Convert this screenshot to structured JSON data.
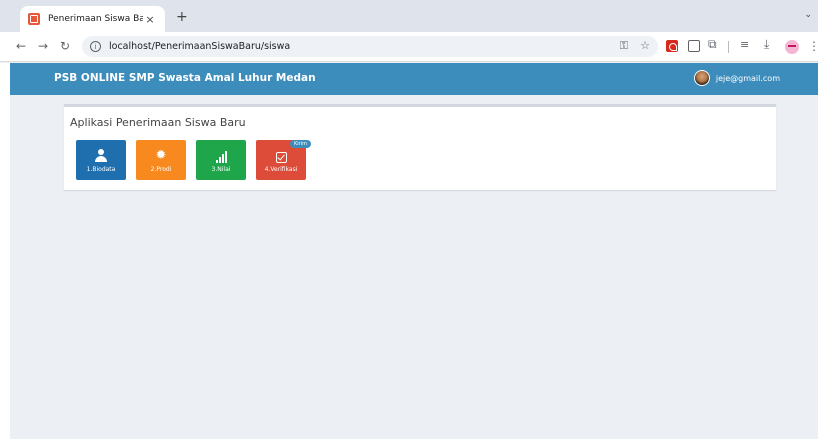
{
  "browser": {
    "tab_title": "Penerimaan Siswa Baru",
    "tab_close": "×",
    "new_tab": "+",
    "tab_menu": "⌄",
    "url": "localhost/PenerimaanSiswaBaru/siswa",
    "icons": [
      "back-arrow",
      "forward-arrow",
      "reload",
      "site-info",
      "password-key",
      "bookmark-star",
      "pdf-extension",
      "extension-box",
      "extensions-puzzle",
      "media-controls",
      "download",
      "profile",
      "menu"
    ]
  },
  "app": {
    "brand": "PSB ONLINE SMP Swasta Amal Luhur Medan",
    "user_email": "jeje@gmail.com",
    "header_color": "#3c8dbc"
  },
  "panel": {
    "title": "Aplikasi Penerimaan Siswa Baru",
    "tiles": [
      {
        "label": "1.Biodata",
        "color": "#1f6fae",
        "icon": "user-icon"
      },
      {
        "label": "2.Prodi",
        "color": "#f7891f",
        "icon": "sun-icon"
      },
      {
        "label": "3.Nilai",
        "color": "#1fa64a",
        "icon": "signal-icon"
      },
      {
        "label": "4.Verifikasi",
        "color": "#dd4b39",
        "icon": "check-square-icon"
      }
    ],
    "badge": "Kirim"
  }
}
